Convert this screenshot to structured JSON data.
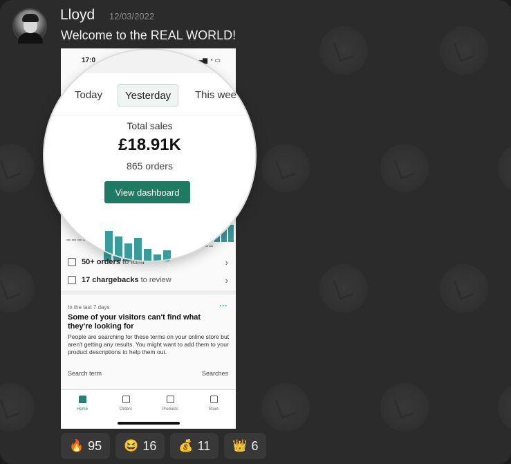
{
  "message": {
    "username": "Lloyd",
    "timestamp": "12/03/2022",
    "text": "Welcome to the REAL WORLD!"
  },
  "screenshot": {
    "status_time": "17:0",
    "tabs": [
      "Today",
      "Yesterday",
      "This wee"
    ],
    "active_tab": "Yesterday",
    "total_sales_label": "Total sales",
    "total_sales_value": "£18.91K",
    "orders": "865 orders",
    "dashboard_button": "View dashboard",
    "tasks": [
      {
        "bold": "50+ orders",
        "rest": " to fulfil"
      },
      {
        "bold": "17 chargebacks",
        "rest": " to review"
      }
    ],
    "insight": {
      "label": "In the last 7 days",
      "title": "Some of your visitors can't find what they're looking for",
      "body": "People are searching for these terms on your online store but aren't getting any results. You might want to add them to your product descriptions to help them out.",
      "col_left": "Search term",
      "col_right": "Searches"
    },
    "nav": [
      "Home",
      "Orders",
      "Products",
      "Store"
    ],
    "active_nav": "Home"
  },
  "reactions": [
    {
      "icon": "fire",
      "emoji": "🔥",
      "count": "95"
    },
    {
      "icon": "grinning-face",
      "emoji": "😆",
      "count": "16"
    },
    {
      "icon": "money-bag",
      "emoji": "💰",
      "count": "11"
    },
    {
      "icon": "crown",
      "emoji": "👑",
      "count": "6"
    }
  ],
  "colors": {
    "background": "#2b2b2b",
    "accent_green": "#1f7a62",
    "chart_teal": "#3a9b9b"
  }
}
